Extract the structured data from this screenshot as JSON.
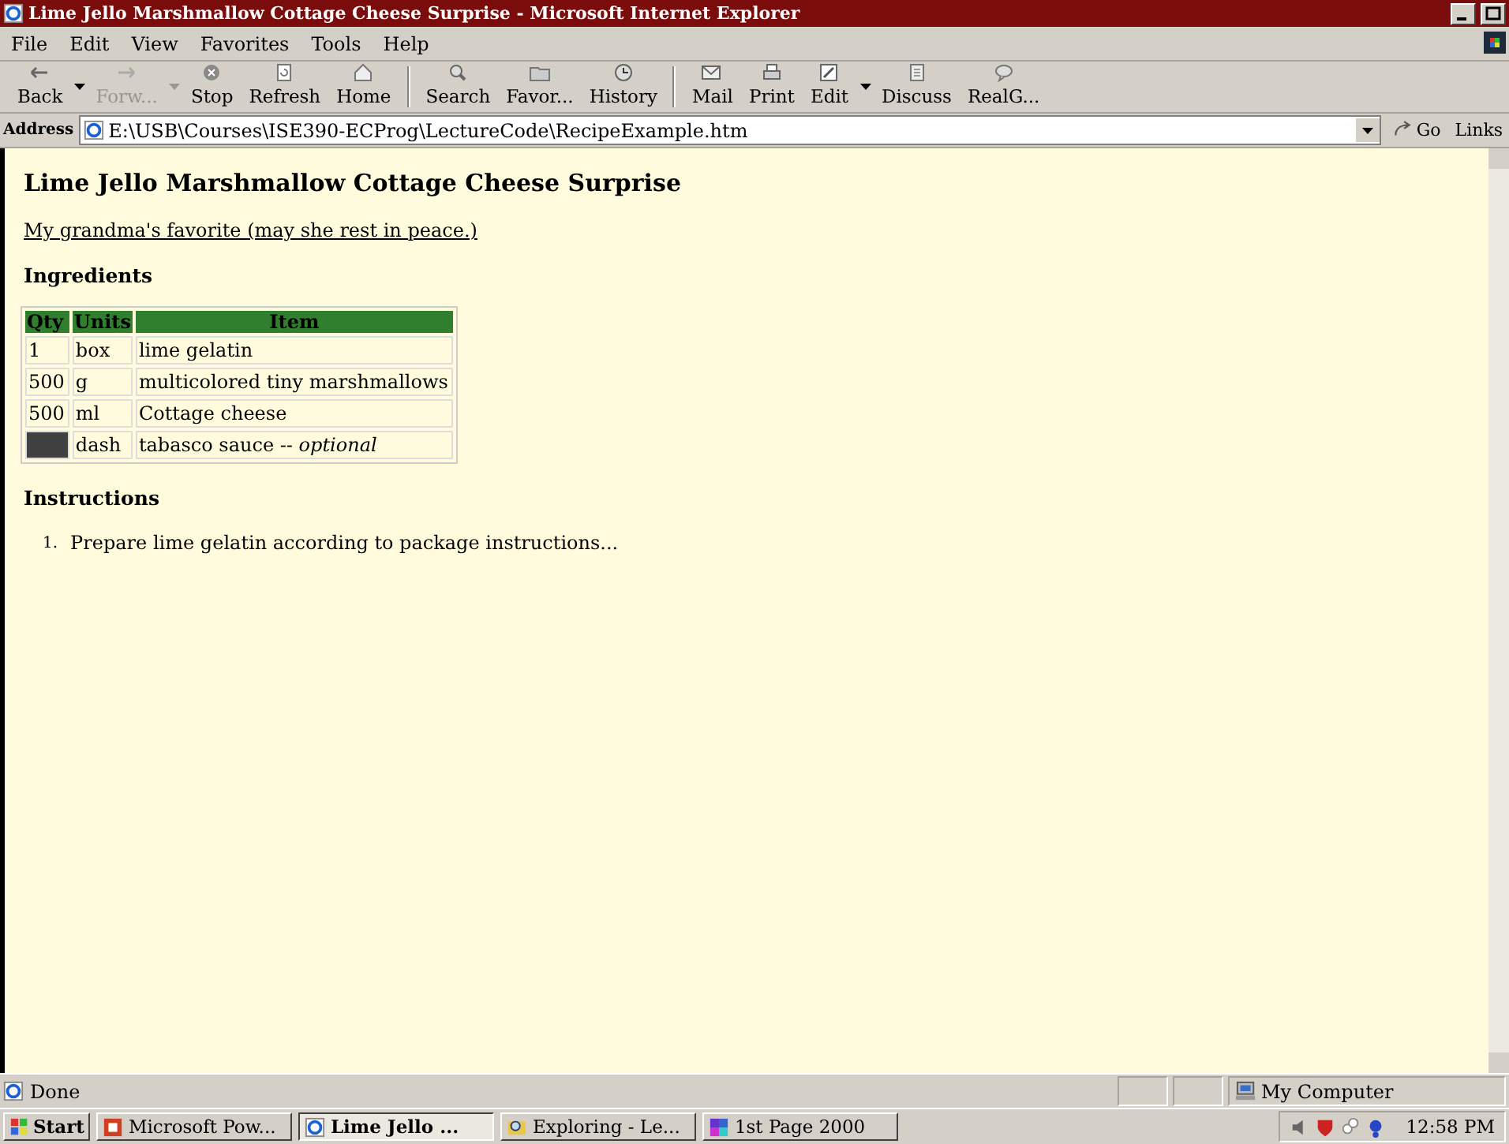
{
  "window": {
    "title": "Lime Jello Marshmallow Cottage Cheese Surprise - Microsoft Internet Explorer"
  },
  "menu": [
    "File",
    "Edit",
    "View",
    "Favorites",
    "Tools",
    "Help"
  ],
  "toolbar": [
    {
      "label": "Back",
      "disabled": false,
      "dropdown": true
    },
    {
      "label": "Forw...",
      "disabled": true,
      "dropdown": true
    },
    {
      "label": "Stop",
      "disabled": false,
      "dropdown": false
    },
    {
      "label": "Refresh",
      "disabled": false,
      "dropdown": false
    },
    {
      "label": "Home",
      "disabled": false,
      "dropdown": false,
      "separator_after": true
    },
    {
      "label": "Search",
      "disabled": false,
      "dropdown": false
    },
    {
      "label": "Favor...",
      "disabled": false,
      "dropdown": false
    },
    {
      "label": "History",
      "disabled": false,
      "dropdown": false,
      "separator_after": true
    },
    {
      "label": "Mail",
      "disabled": false,
      "dropdown": false
    },
    {
      "label": "Print",
      "disabled": false,
      "dropdown": false
    },
    {
      "label": "Edit",
      "disabled": false,
      "dropdown": true
    },
    {
      "label": "Discuss",
      "disabled": false,
      "dropdown": false
    },
    {
      "label": "RealG...",
      "disabled": false,
      "dropdown": false
    }
  ],
  "address": {
    "label": "Address",
    "value": "E:\\USB\\Courses\\ISE390-ECProg\\LectureCode\\RecipeExample.htm",
    "go": "Go",
    "links": "Links"
  },
  "page": {
    "heading": "Lime Jello Marshmallow Cottage Cheese Surprise",
    "subtitle": "My grandma's favorite (may she rest in peace.)",
    "ingredients_heading": "Ingredients",
    "table": {
      "columns": [
        "Qty",
        "Units",
        "Item"
      ],
      "rows": [
        {
          "qty": "1",
          "units": "box",
          "item": "lime gelatin",
          "qty_blacked_out": false
        },
        {
          "qty": "500",
          "units": "g",
          "item": "multicolored tiny marshmallows",
          "qty_blacked_out": false
        },
        {
          "qty": "500",
          "units": "ml",
          "item": "Cottage cheese",
          "qty_blacked_out": false
        },
        {
          "units": "dash",
          "item": "tabasco sauce -- *optional*",
          "qty_blacked_out": true
        }
      ]
    },
    "instructions_heading": "Instructions",
    "steps": [
      {
        "number": "1.",
        "text": "Prepare lime gelatin according to package instructions..."
      }
    ]
  },
  "status_bar": {
    "text": "Done",
    "zone": "My Computer"
  },
  "taskbar": {
    "start": "Start",
    "buttons": [
      {
        "label": "Microsoft Pow...",
        "selected": false
      },
      {
        "label": "Lime Jello ...",
        "selected": true
      },
      {
        "label": "Exploring - Le...",
        "selected": false
      },
      {
        "label": "1st Page 2000",
        "selected": false
      }
    ],
    "clock": "12:58 PM"
  }
}
